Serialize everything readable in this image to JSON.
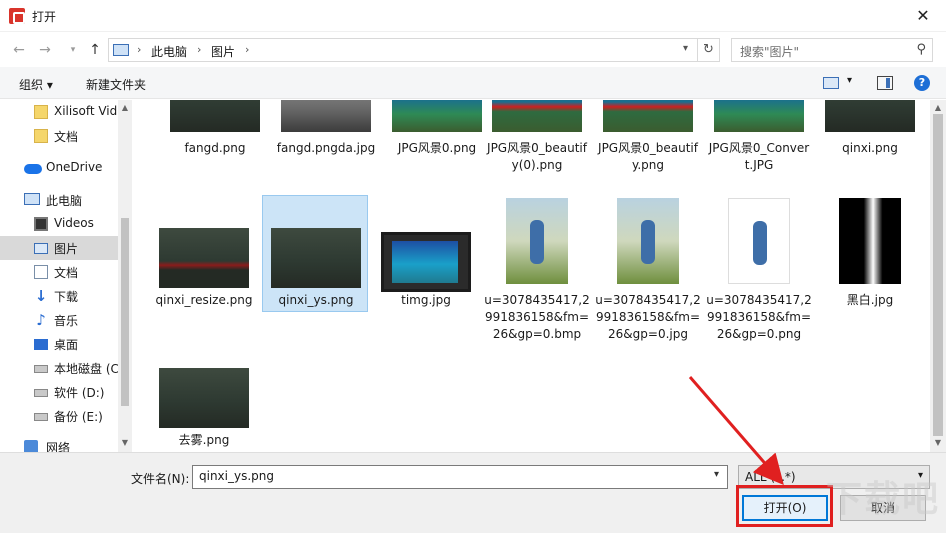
{
  "window": {
    "title": "打开"
  },
  "navbar": {
    "breadcrumb": [
      "此电脑",
      "图片"
    ],
    "search_placeholder": "搜索\"图片\""
  },
  "toolbar": {
    "organize": "组织 ▾",
    "new_folder": "新建文件夹",
    "help": "?"
  },
  "sidebar": {
    "items": [
      {
        "label": "Xilisoft Vid",
        "icon": "folder-icon"
      },
      {
        "label": "文档",
        "icon": "folder-icon"
      },
      {
        "label": "OneDrive",
        "icon": "cloud-icon"
      },
      {
        "label": "此电脑",
        "icon": "computer-icon"
      },
      {
        "label": "Videos",
        "icon": "video-icon"
      },
      {
        "label": "图片",
        "icon": "pictures-icon",
        "selected": true
      },
      {
        "label": "文档",
        "icon": "documents-icon"
      },
      {
        "label": "下载",
        "icon": "download-icon"
      },
      {
        "label": "音乐",
        "icon": "music-icon"
      },
      {
        "label": "桌面",
        "icon": "desktop-icon"
      },
      {
        "label": "本地磁盘 (C",
        "icon": "disk-icon"
      },
      {
        "label": "软件 (D:)",
        "icon": "disk-icon"
      },
      {
        "label": "备份 (E:)",
        "icon": "disk-icon"
      },
      {
        "label": "网络",
        "icon": "network-icon"
      }
    ]
  },
  "files": [
    {
      "name": "fangd.png",
      "thumb": "dark"
    },
    {
      "name": "fangd.pngda.jpg",
      "thumb": "bw"
    },
    {
      "name": "JPG风景0.png",
      "thumb": "lake"
    },
    {
      "name": "JPG风景0_beautify(0).png",
      "thumb": "lake-red"
    },
    {
      "name": "JPG风景0_beautify.png",
      "thumb": "lake-red"
    },
    {
      "name": "JPG风景0_Convert.JPG",
      "thumb": "lake"
    },
    {
      "name": "qinxi.png",
      "thumb": "dark"
    },
    {
      "name": "qinxi_resize.png",
      "thumb": "dark-red"
    },
    {
      "name": "qinxi_ys.png",
      "thumb": "dark",
      "selected": true
    },
    {
      "name": "timg.jpg",
      "thumb": "screen"
    },
    {
      "name": "u=3078435417,2991836158&fm=26&gp=0.bmp",
      "thumb": "portrait"
    },
    {
      "name": "u=3078435417,2991836158&fm=26&gp=0.jpg",
      "thumb": "portrait"
    },
    {
      "name": "u=3078435417,2991836158&fm=26&gp=0.png",
      "thumb": "portrait-white"
    },
    {
      "name": "黑白.jpg",
      "thumb": "bwtree"
    },
    {
      "name": "去雾.png",
      "thumb": "dark"
    }
  ],
  "footer": {
    "filename_label": "文件名(N):",
    "filename_value": "qinxi_ys.png",
    "filter": "ALL (*.*)",
    "open_label": "打开(O)",
    "cancel_label": "取消"
  },
  "watermark": "下载吧",
  "colors": {
    "accent": "#0078d7",
    "selection": "#cce4f7",
    "annotation": "#e02020"
  }
}
